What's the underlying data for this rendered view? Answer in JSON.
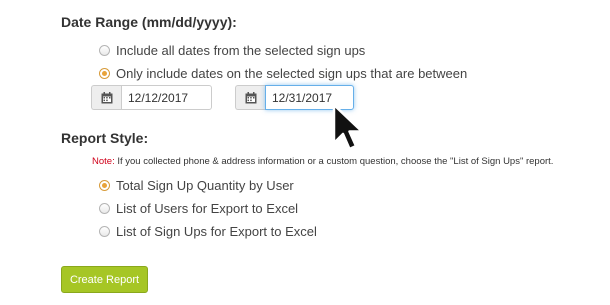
{
  "date_range": {
    "title": "Date Range (mm/dd/yyyy):",
    "options": [
      {
        "label": "Include all dates from the selected sign ups",
        "checked": false
      },
      {
        "label": "Only include dates on the selected sign ups that are between",
        "checked": true
      }
    ],
    "start_date": "12/12/2017",
    "end_date": "12/31/2017",
    "calendar_icon": "calendar-icon"
  },
  "report_style": {
    "title": "Report Style:",
    "note_label": "Note:",
    "note_text": " If you collected phone & address information or a custom question, choose the \"List of Sign Ups\" report.",
    "options": [
      {
        "label": "Total Sign Up Quantity by User",
        "checked": true
      },
      {
        "label": "List of Users for Export to Excel",
        "checked": false
      },
      {
        "label": "List of Sign Ups for Export to Excel",
        "checked": false
      }
    ]
  },
  "create_button_label": "Create Report",
  "colors": {
    "accent_radio": "#e8a33a",
    "button_green": "#a6c625",
    "note_red": "#d0021b",
    "focus_blue": "#66afe9"
  },
  "cursor_icon": "mouse-pointer-icon"
}
